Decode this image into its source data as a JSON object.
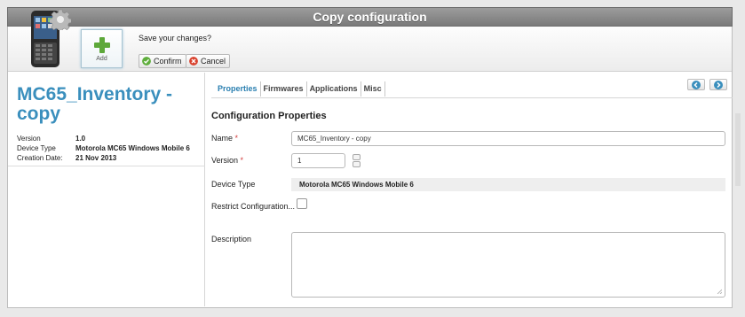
{
  "window": {
    "title": "Copy configuration"
  },
  "toolbar": {
    "add_label": "Add",
    "save_prompt": "Save your changes?",
    "confirm_label": "Confirm",
    "cancel_label": "Cancel"
  },
  "config": {
    "title": "MC65_Inventory - copy",
    "meta": [
      {
        "key": "Version",
        "value": "1.0"
      },
      {
        "key": "Device Type",
        "value": "Motorola MC65 Windows Mobile 6"
      },
      {
        "key": "Creation Date:",
        "value": "21 Nov 2013"
      }
    ]
  },
  "tabs": [
    {
      "label": "Properties",
      "active": true
    },
    {
      "label": "Firmwares",
      "active": false
    },
    {
      "label": "Applications",
      "active": false
    },
    {
      "label": "Misc",
      "active": false
    }
  ],
  "form": {
    "section_title": "Configuration Properties",
    "name_label": "Name",
    "name_value": "MC65_Inventory - copy",
    "version_label": "Version",
    "version_value": "1",
    "device_type_label": "Device Type",
    "device_type_value": "Motorola MC65 Windows Mobile 6",
    "restrict_label": "Restrict Configuration...",
    "restrict_checked": false,
    "description_label": "Description",
    "description_value": "",
    "required_mark": "*"
  },
  "colors": {
    "accent": "#3a8fbd",
    "required": "#d23c3c",
    "confirm_icon": "#5fae3c",
    "cancel_icon": "#d9432f"
  },
  "icons": {
    "device": "handheld-device-icon",
    "gear": "gear-icon",
    "add": "plus-icon",
    "confirm": "check-icon",
    "cancel": "cancel-icon",
    "prev": "arrow-left-icon",
    "next": "arrow-right-icon"
  }
}
